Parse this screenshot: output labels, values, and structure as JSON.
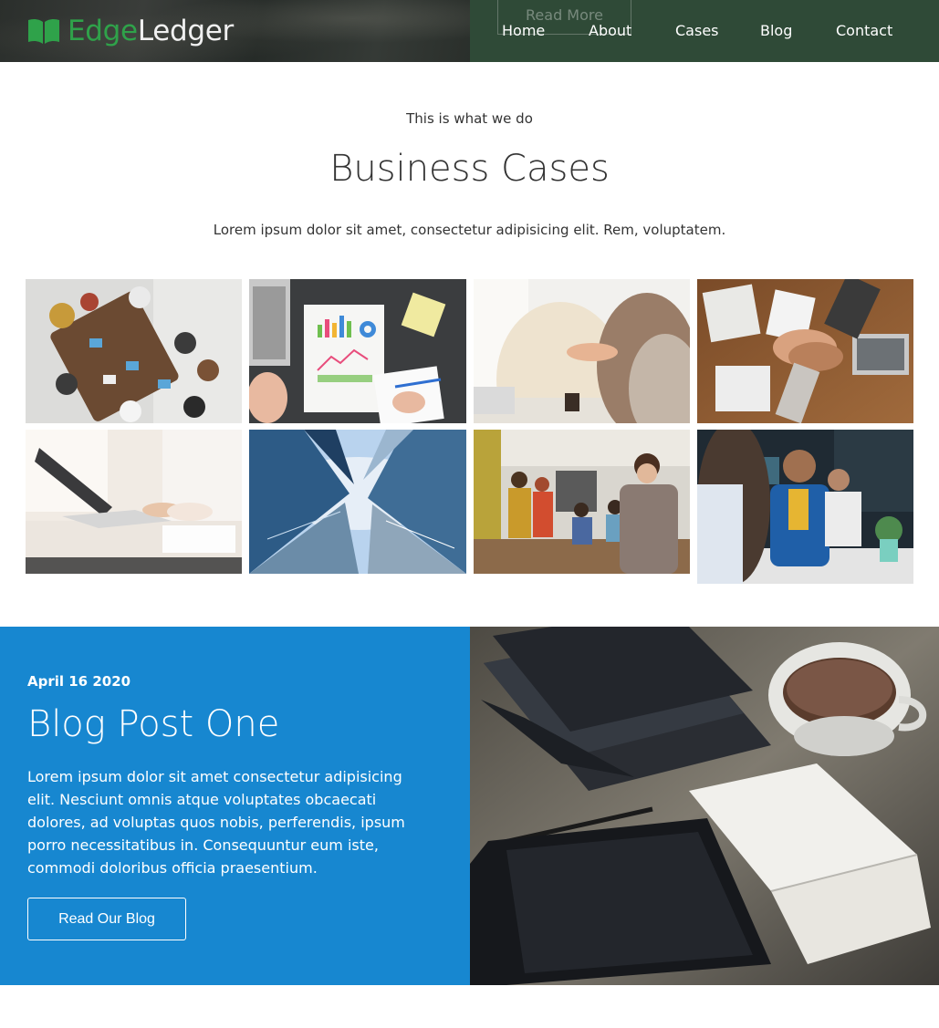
{
  "brand": {
    "part1": "Edge",
    "part2": "Ledger",
    "icon": "open-book-icon"
  },
  "hero": {
    "read_more_label": "Read More"
  },
  "nav": {
    "items": [
      {
        "label": "Home"
      },
      {
        "label": "About"
      },
      {
        "label": "Cases"
      },
      {
        "label": "Blog"
      },
      {
        "label": "Contact"
      }
    ]
  },
  "cases": {
    "eyebrow": "This is what we do",
    "title": "Business Cases",
    "subtitle": "Lorem ipsum dolor sit amet, consectetur adipisicing elit. Rem, voluptatem."
  },
  "blog": {
    "date": "April 16 2020",
    "title": "Blog Post One",
    "text": "Lorem ipsum dolor sit amet consectetur adipisicing elit. Nesciunt omnis atque voluptates obcaecati dolores, ad voluptas quos nobis, perferendis, ipsum porro necessitatibus in. Consequuntur eum iste, commodi doloribus officia praesentium.",
    "button_label": "Read Our Blog"
  },
  "colors": {
    "brand_green": "#2fa24a",
    "nav_bg": "#2f4a37",
    "blog_blue": "#1787d0"
  }
}
